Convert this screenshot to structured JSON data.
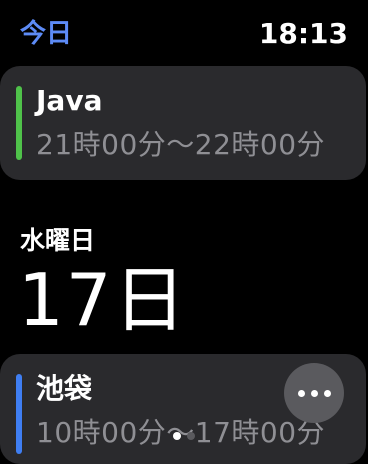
{
  "header": {
    "back_label": "今日",
    "clock": "18:13"
  },
  "events_today": [
    {
      "title": "Java",
      "time": "21時00分〜22時00分",
      "color": "#4fc24a"
    }
  ],
  "date_section": {
    "weekday": "水曜日",
    "day": "17日"
  },
  "events_next": [
    {
      "title": "池袋",
      "time": "10時00分〜17時00分",
      "color": "#3f7ef2"
    }
  ],
  "more_button": {
    "icon": "ellipsis-icon"
  },
  "page_indicator": {
    "count": 2,
    "current": 1,
    "active_color": "#ffffff",
    "inactive_color": "#5a5a5e"
  }
}
